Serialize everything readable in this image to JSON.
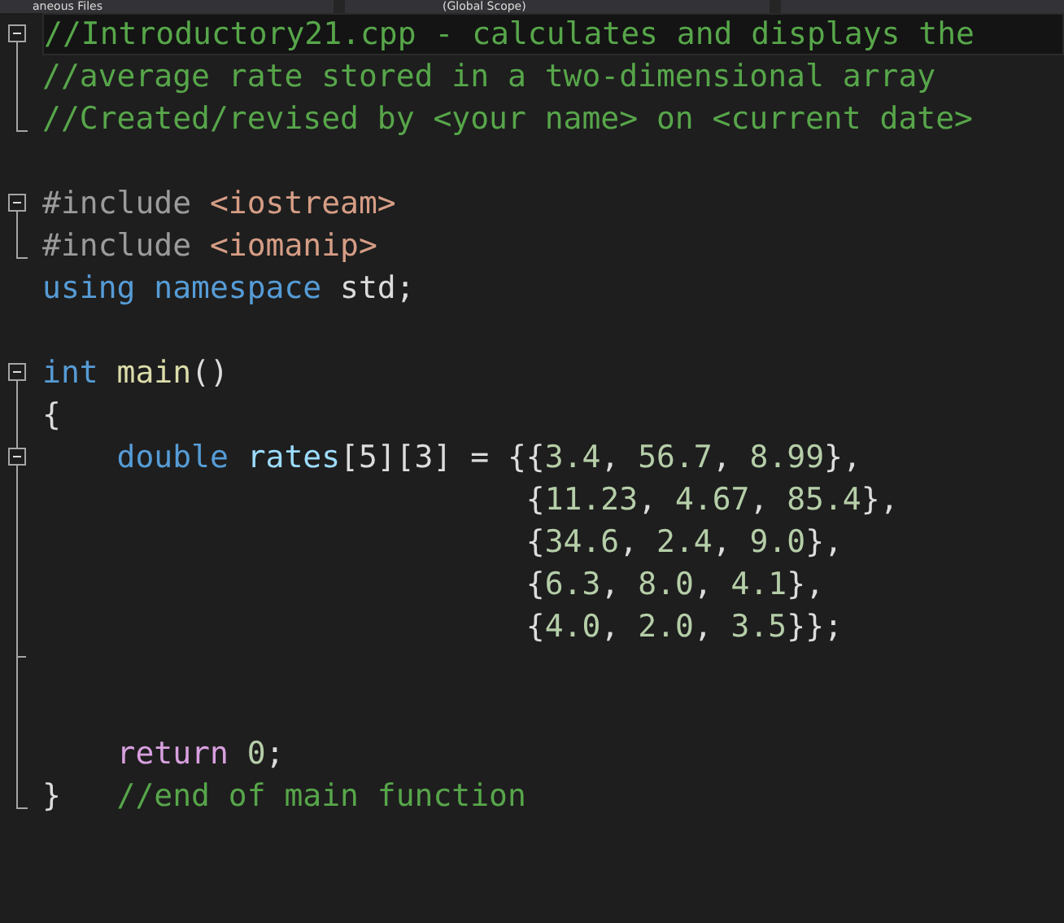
{
  "navigation_bar": [
    {
      "label": "aneous Files"
    },
    {
      "label": "(Global Scope)"
    }
  ],
  "lines": [
    {
      "kind": "open",
      "current": true,
      "tokens": [
        {
          "kind": "comment",
          "text": "//Introductory21.cpp - calculates and displays the"
        }
      ]
    },
    {
      "kind": "line",
      "current": false,
      "tokens": [
        {
          "kind": "comment",
          "text": "//average rate stored in a two-dimensional array"
        }
      ]
    },
    {
      "kind": "end",
      "current": false,
      "tokens": [
        {
          "kind": "comment",
          "text": "//Created/revised by <your name> on <current date>"
        }
      ]
    },
    {
      "kind": "none",
      "current": false
    },
    {
      "kind": "open",
      "current": false,
      "tokens": [
        {
          "kind": "preprocessor",
          "text": "#include "
        },
        {
          "kind": "string",
          "text": "<iostream>"
        }
      ]
    },
    {
      "kind": "end",
      "current": false,
      "tokens": [
        {
          "kind": "preprocessor",
          "text": "#include "
        },
        {
          "kind": "string",
          "text": "<iomanip>"
        }
      ]
    },
    {
      "kind": "none",
      "current": false,
      "tokens": [
        {
          "kind": "keyword",
          "text": "using namespace "
        },
        {
          "kind": "plain",
          "text": "std;"
        }
      ]
    },
    {
      "kind": "none",
      "current": false
    },
    {
      "kind": "open",
      "current": false,
      "tokens": [
        {
          "kind": "keyword",
          "text": "int "
        },
        {
          "kind": "function",
          "text": "main"
        },
        {
          "kind": "plain",
          "text": "()"
        }
      ]
    },
    {
      "kind": "line",
      "current": false,
      "tokens": [
        {
          "kind": "plain",
          "text": "{"
        }
      ]
    },
    {
      "kind": "open",
      "current": false,
      "tokens": [
        {
          "kind": "keyword",
          "text": "    double "
        },
        {
          "kind": "variable",
          "text": "rates"
        },
        {
          "kind": "plain",
          "text": "[5][3] = {{"
        },
        {
          "kind": "number",
          "text": "3.4"
        },
        {
          "kind": "plain",
          "text": ", "
        },
        {
          "kind": "number",
          "text": "56.7"
        },
        {
          "kind": "plain",
          "text": ", "
        },
        {
          "kind": "number",
          "text": "8.99"
        },
        {
          "kind": "plain",
          "text": "},"
        }
      ]
    },
    {
      "kind": "line",
      "current": false,
      "tokens": [
        {
          "kind": "plain",
          "text": "                          {"
        },
        {
          "kind": "number",
          "text": "11.23"
        },
        {
          "kind": "plain",
          "text": ", "
        },
        {
          "kind": "number",
          "text": "4.67"
        },
        {
          "kind": "plain",
          "text": ", "
        },
        {
          "kind": "number",
          "text": "85.4"
        },
        {
          "kind": "plain",
          "text": "},"
        }
      ]
    },
    {
      "kind": "line",
      "current": false,
      "tokens": [
        {
          "kind": "plain",
          "text": "                          {"
        },
        {
          "kind": "number",
          "text": "34.6"
        },
        {
          "kind": "plain",
          "text": ", "
        },
        {
          "kind": "number",
          "text": "2.4"
        },
        {
          "kind": "plain",
          "text": ", "
        },
        {
          "kind": "number",
          "text": "9.0"
        },
        {
          "kind": "plain",
          "text": "},"
        }
      ]
    },
    {
      "kind": "line",
      "current": false,
      "tokens": [
        {
          "kind": "plain",
          "text": "                          {"
        },
        {
          "kind": "number",
          "text": "6.3"
        },
        {
          "kind": "plain",
          "text": ", "
        },
        {
          "kind": "number",
          "text": "8.0"
        },
        {
          "kind": "plain",
          "text": ", "
        },
        {
          "kind": "number",
          "text": "4.1"
        },
        {
          "kind": "plain",
          "text": "},"
        }
      ]
    },
    {
      "kind": "line",
      "current": false,
      "tokens": [
        {
          "kind": "plain",
          "text": "                          {"
        },
        {
          "kind": "number",
          "text": "4.0"
        },
        {
          "kind": "plain",
          "text": ", "
        },
        {
          "kind": "number",
          "text": "2.0"
        },
        {
          "kind": "plain",
          "text": ", "
        },
        {
          "kind": "number",
          "text": "3.5"
        },
        {
          "kind": "plain",
          "text": "}};"
        }
      ]
    },
    {
      "kind": "subend",
      "current": false
    },
    {
      "kind": "line",
      "current": false
    },
    {
      "kind": "line",
      "current": false,
      "tokens": [
        {
          "kind": "control",
          "text": "    return "
        },
        {
          "kind": "number",
          "text": "0"
        },
        {
          "kind": "plain",
          "text": ";"
        }
      ]
    },
    {
      "kind": "end",
      "current": false,
      "tokens": [
        {
          "kind": "plain",
          "text": "}   "
        },
        {
          "kind": "comment",
          "text": "//end of main function"
        }
      ]
    }
  ]
}
